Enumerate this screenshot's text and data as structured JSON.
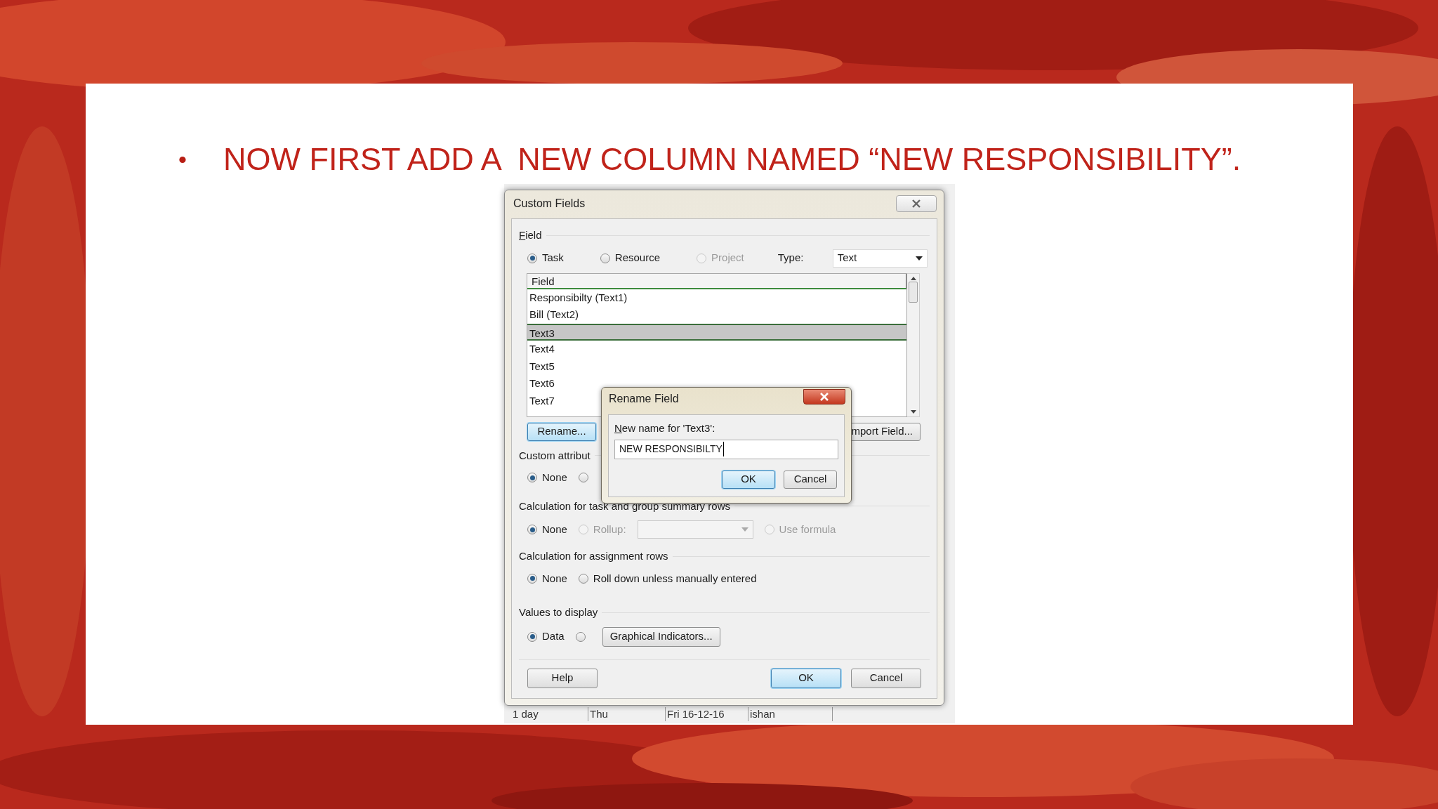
{
  "slide": {
    "bullet": "•",
    "title": "NOW FIRST ADD A  NEW COLUMN NAMED “NEW RESPONSIBILITY”."
  },
  "dialog": {
    "title": "Custom Fields",
    "field_group": {
      "label": "Field",
      "row": [
        {
          "kind": "radio",
          "label": "Task",
          "selected": true,
          "disabled": false
        },
        {
          "kind": "radio",
          "label": "Resource",
          "selected": false,
          "disabled": false
        },
        {
          "kind": "radio",
          "label": "Project",
          "selected": false,
          "disabled": true
        }
      ],
      "type_label": "Type:",
      "type_value": "Text"
    },
    "field_list": {
      "header": "Field",
      "items": [
        {
          "label": "Responsibilty (Text1)",
          "selected": false
        },
        {
          "label": "Bill (Text2)",
          "selected": false
        },
        {
          "label": "Text3",
          "selected": true
        },
        {
          "label": "Text4",
          "selected": false
        },
        {
          "label": "Text5",
          "selected": false
        },
        {
          "label": "Text6",
          "selected": false
        },
        {
          "label": "Text7",
          "selected": false
        }
      ]
    },
    "list_buttons": [
      {
        "label": "Rename...",
        "default": true
      },
      {
        "label": "mport Field...",
        "default": false
      }
    ],
    "sections": [
      {
        "label": "Custom attribut",
        "row": [
          {
            "kind": "radio",
            "label": "None",
            "selected": true,
            "disabled": false
          },
          {
            "kind": "radio",
            "selected": false,
            "disabled": false
          }
        ]
      },
      {
        "label": "Calculation for task and group summary rows",
        "row": [
          {
            "kind": "radio",
            "label": "None",
            "selected": true,
            "disabled": false
          },
          {
            "kind": "radio",
            "label": "Rollup:",
            "selected": false,
            "disabled": true
          },
          {
            "kind": "dropdown",
            "disabled": true
          },
          {
            "kind": "radio",
            "label": "Use formula",
            "selected": false,
            "disabled": true
          }
        ]
      },
      {
        "label": "Calculation for assignment rows",
        "row": [
          {
            "kind": "radio",
            "label": "None",
            "selected": true,
            "disabled": false
          },
          {
            "kind": "radio",
            "label": "Roll down unless manually entered",
            "selected": false,
            "disabled": false
          }
        ]
      },
      {
        "label": "Values to display",
        "row": [
          {
            "kind": "radio",
            "label": "Data",
            "selected": true,
            "disabled": false
          },
          {
            "kind": "radio",
            "selected": false,
            "disabled": false
          },
          {
            "kind": "button",
            "label": "Graphical Indicators...",
            "default": false
          }
        ]
      }
    ],
    "footer": {
      "left": [
        {
          "label": "Help",
          "default": false
        }
      ],
      "right": [
        {
          "label": "OK",
          "default": true
        },
        {
          "label": "Cancel",
          "default": false
        }
      ]
    }
  },
  "rename_dialog": {
    "title": "Rename Field",
    "label": "New name for 'Text3':",
    "value": "NEW RESPONSIBILTY",
    "buttons": [
      {
        "label": "OK",
        "default": true
      },
      {
        "label": "Cancel",
        "default": false
      }
    ]
  },
  "background_sheet": {
    "cells": [
      "1 day",
      "Thu",
      "Fri 16-12-16",
      "ishan"
    ]
  }
}
